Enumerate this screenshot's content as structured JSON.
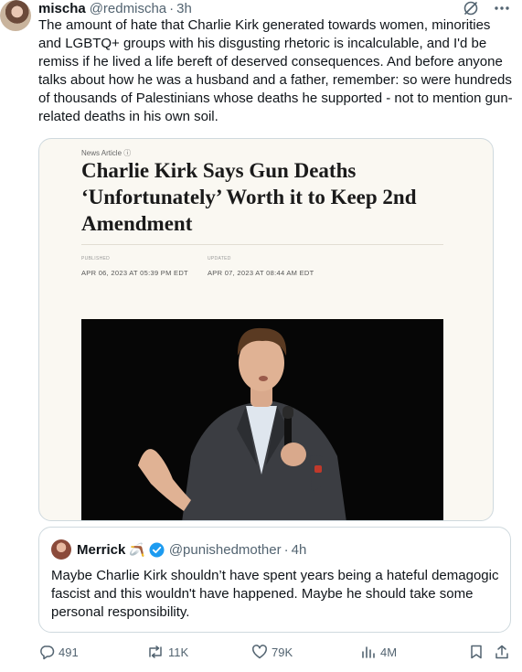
{
  "tweet": {
    "author_name": "mischa",
    "handle": "@redmischa",
    "separator": "·",
    "time": "3h",
    "text": "The amount of hate that Charlie Kirk generated towards women, minorities and LGBTQ+ groups with his disgusting rhetoric is incalculable, and I'd be remiss if he lived a life bereft of deserved consequences. And before anyone talks about how he was a husband and a father, remember: so were hundreds of thousands of Palestinians whose deaths he supported - not to mention gun-related deaths in his own soil."
  },
  "article": {
    "label": "News Article ⓘ",
    "headline": "Charlie Kirk Says Gun Deaths ‘Unfortunately’ Worth it to Keep 2nd Amendment",
    "published_label": "PUBLISHED",
    "published_value": "APR 06, 2023 AT 05:39 PM EDT",
    "updated_label": "UPDATED",
    "updated_value": "APR 07, 2023 AT 08:44 AM EDT"
  },
  "quote": {
    "author_name": "Merrick",
    "emoji": "🪃",
    "handle": "@punishedmother",
    "separator": "·",
    "time": "4h",
    "text": "Maybe Charlie Kirk shouldn’t have spent years being a hateful demagogic fascist and this wouldn't have happened. Maybe he should take some personal responsibility."
  },
  "actions": {
    "replies": "491",
    "reposts": "11K",
    "likes": "79K",
    "views": "4M"
  },
  "colors": {
    "text": "#0f1419",
    "muted": "#536471",
    "border": "#cfd9de",
    "verified": "#1d9bf0"
  },
  "icons": {
    "grok": "grok-icon",
    "more": "more-icon",
    "reply": "reply-icon",
    "repost": "repost-icon",
    "like": "heart-icon",
    "views": "views-icon",
    "bookmark": "bookmark-icon",
    "share": "share-icon"
  }
}
